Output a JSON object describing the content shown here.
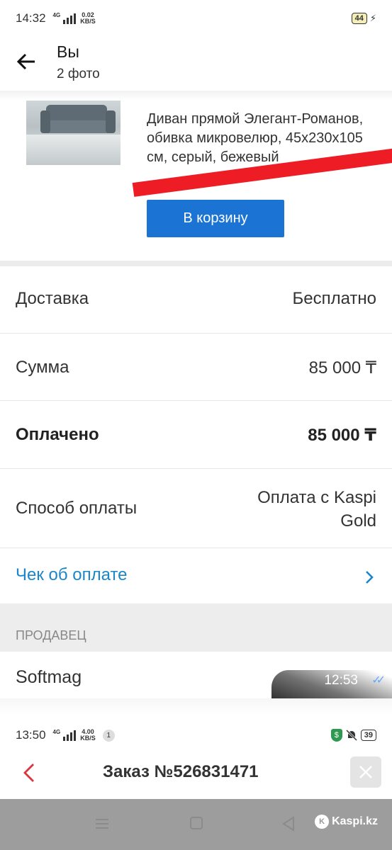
{
  "status_bar_top": {
    "time": "14:32",
    "network": "4G",
    "speed_value": "0.02",
    "speed_unit": "KB/S",
    "battery": "44"
  },
  "header": {
    "title": "Вы",
    "subtitle": "2 фото"
  },
  "product": {
    "title": "Диван прямой Элегант-Романов, обивка микровелюр, 45x230x105 см, серый, бежевый",
    "cart_button": "В корзину"
  },
  "order_rows": [
    {
      "label": "Доставка",
      "value": "Бесплатно"
    },
    {
      "label": "Сумма",
      "value": "85 000 ₸"
    },
    {
      "label": "Оплачено",
      "value": "85 000 ₸"
    },
    {
      "label": "Способ оплаты",
      "value_line1": "Оплата с Kaspi",
      "value_line2": "Gold"
    }
  ],
  "receipt_link": "Чек об оплате",
  "seller": {
    "header": "ПРОДАВЕЦ",
    "name": "Softmag"
  },
  "message": {
    "time": "12:53"
  },
  "status_bar_bottom": {
    "time": "13:50",
    "network": "4G",
    "speed_value": "4.00",
    "speed_unit": "KB/S",
    "notif_count": "1",
    "battery": "39"
  },
  "order_header": {
    "title": "Заказ №526831471"
  },
  "watermark": "Kaspi.kz",
  "colors": {
    "accent": "#1b74d4",
    "link": "#1b86c8",
    "stripe": "#ee1c25",
    "back_arrow_red": "#d9363e"
  }
}
